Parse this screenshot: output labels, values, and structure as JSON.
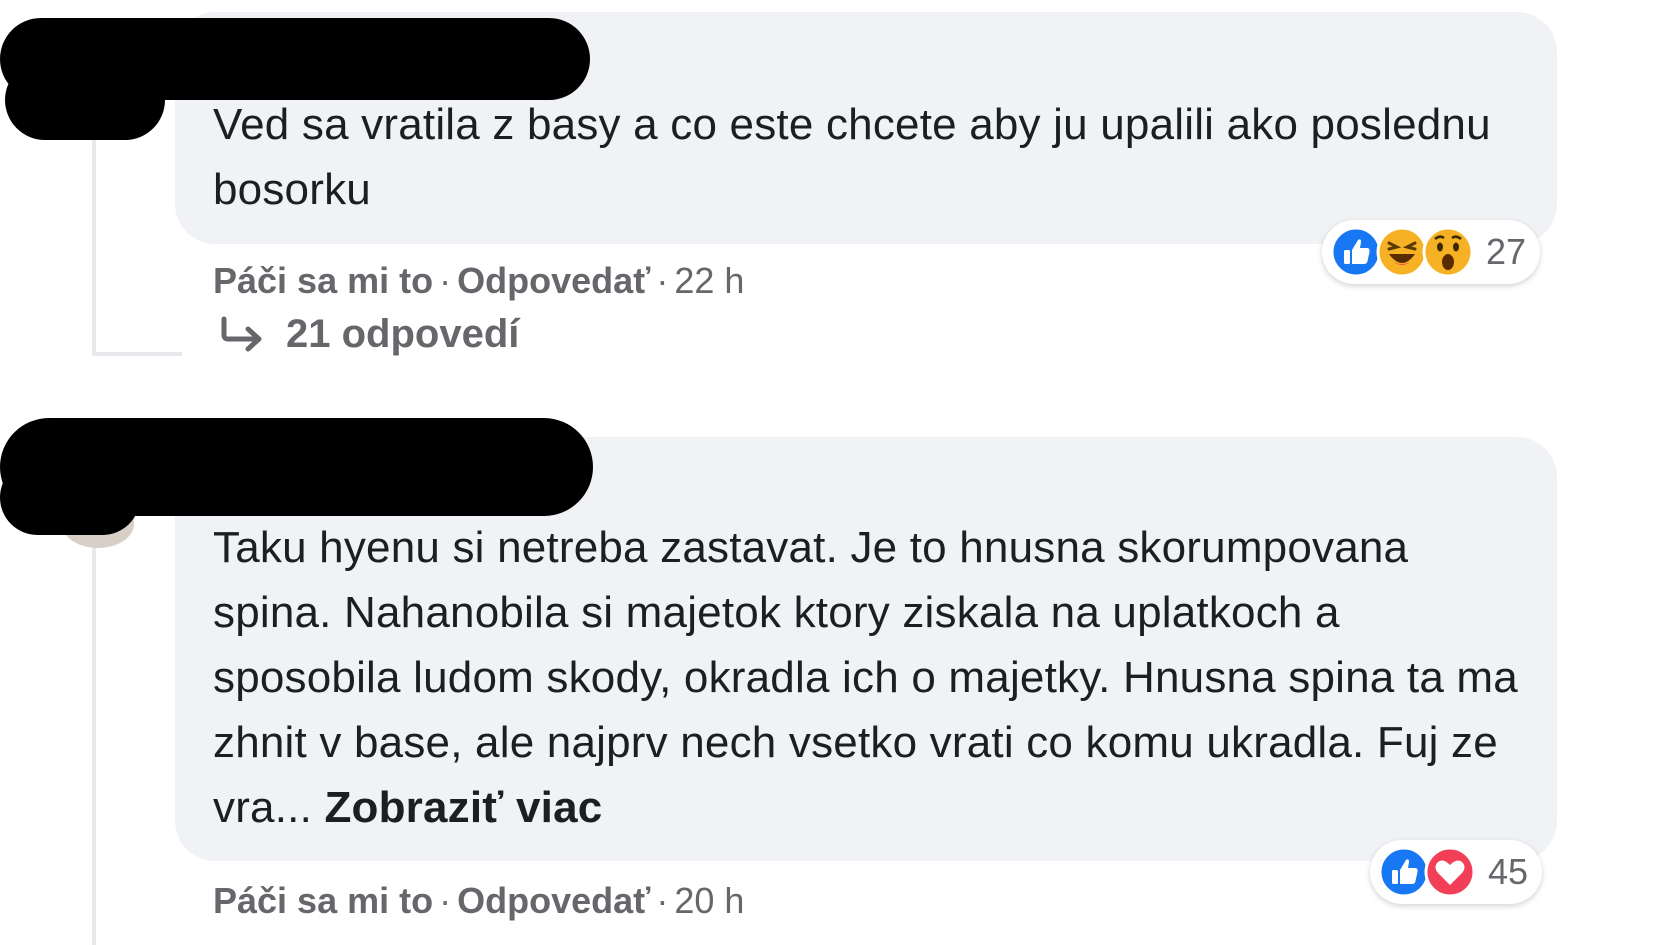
{
  "comments": [
    {
      "text": "Ved sa vratila z basy a co este chcete aby ju upalili ako poslednu bosorku",
      "like_label": "Páči sa mi to",
      "reply_label": "Odpovedať",
      "separator": "·",
      "time": "22 h",
      "reaction_icons": [
        "like-icon",
        "haha-icon",
        "wow-icon"
      ],
      "reaction_count": "27",
      "replies_label": "21 odpovedí"
    },
    {
      "text": "Taku hyenu si netreba zastavat. Je to hnusna skorumpovana spina. Nahanobila si majetok ktory ziskala na uplatkoch a sposobila ludom skody, okradla ich o majetky. Hnusna spina ta ma zhnit v base, ale najprv nech vsetko vrati co komu ukradla. Fuj ze vra...",
      "see_more": "Zobraziť viac",
      "like_label": "Páči sa mi to",
      "reply_label": "Odpovedať",
      "separator": "·",
      "time": "20 h",
      "reaction_icons": [
        "like-icon",
        "love-icon"
      ],
      "reaction_count": "45"
    }
  ],
  "colors": {
    "bubble": "#f0f2f5",
    "secondary_text": "#65676b",
    "like_blue": "#1877f2",
    "haha_yellow": "#f7b125",
    "love_red": "#f33e58"
  }
}
